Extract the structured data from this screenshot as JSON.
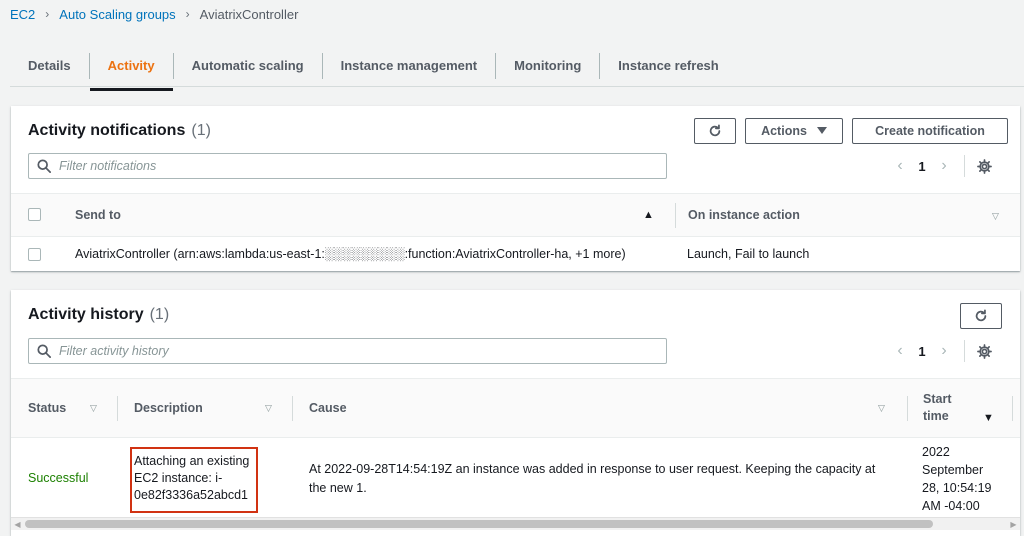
{
  "breadcrumb": {
    "items": [
      "EC2",
      "Auto Scaling groups"
    ],
    "current": "AviatrixController",
    "separator": "›"
  },
  "tabs": [
    {
      "label": "Details",
      "active": false
    },
    {
      "label": "Activity",
      "active": true
    },
    {
      "label": "Automatic scaling",
      "active": false
    },
    {
      "label": "Instance management",
      "active": false
    },
    {
      "label": "Monitoring",
      "active": false
    },
    {
      "label": "Instance refresh",
      "active": false
    }
  ],
  "notifications": {
    "title": "Activity notifications",
    "count": "(1)",
    "actions_label": "Actions",
    "create_label": "Create notification",
    "filter_placeholder": "Filter notifications",
    "page": "1",
    "columns": {
      "send_to": "Send to",
      "on_instance_action": "On instance action"
    },
    "row": {
      "send_to": "AviatrixController (arn:aws:lambda:us-east-1:░░░░░░░░░:function:AviatrixController-ha, +1 more)",
      "on_instance_action": "Launch, Fail to launch"
    }
  },
  "history": {
    "title": "Activity history",
    "count": "(1)",
    "filter_placeholder": "Filter activity history",
    "page": "1",
    "columns": {
      "status": "Status",
      "description": "Description",
      "cause": "Cause",
      "start_time_1": "Start",
      "start_time_2": "time"
    },
    "row": {
      "status": "Successful",
      "description": "Attaching an existing EC2 instance: i-0e82f3336a52abcd1",
      "cause": "At 2022-09-28T14:54:19Z an instance was added in response to user request. Keeping the capacity at the new 1.",
      "start_time": "2022 September 28, 10:54:19 AM -04:00"
    }
  },
  "colors": {
    "accent": "#ec7211",
    "link": "#0073bb",
    "success": "#1d8102",
    "highlight_box": "#d13212"
  }
}
